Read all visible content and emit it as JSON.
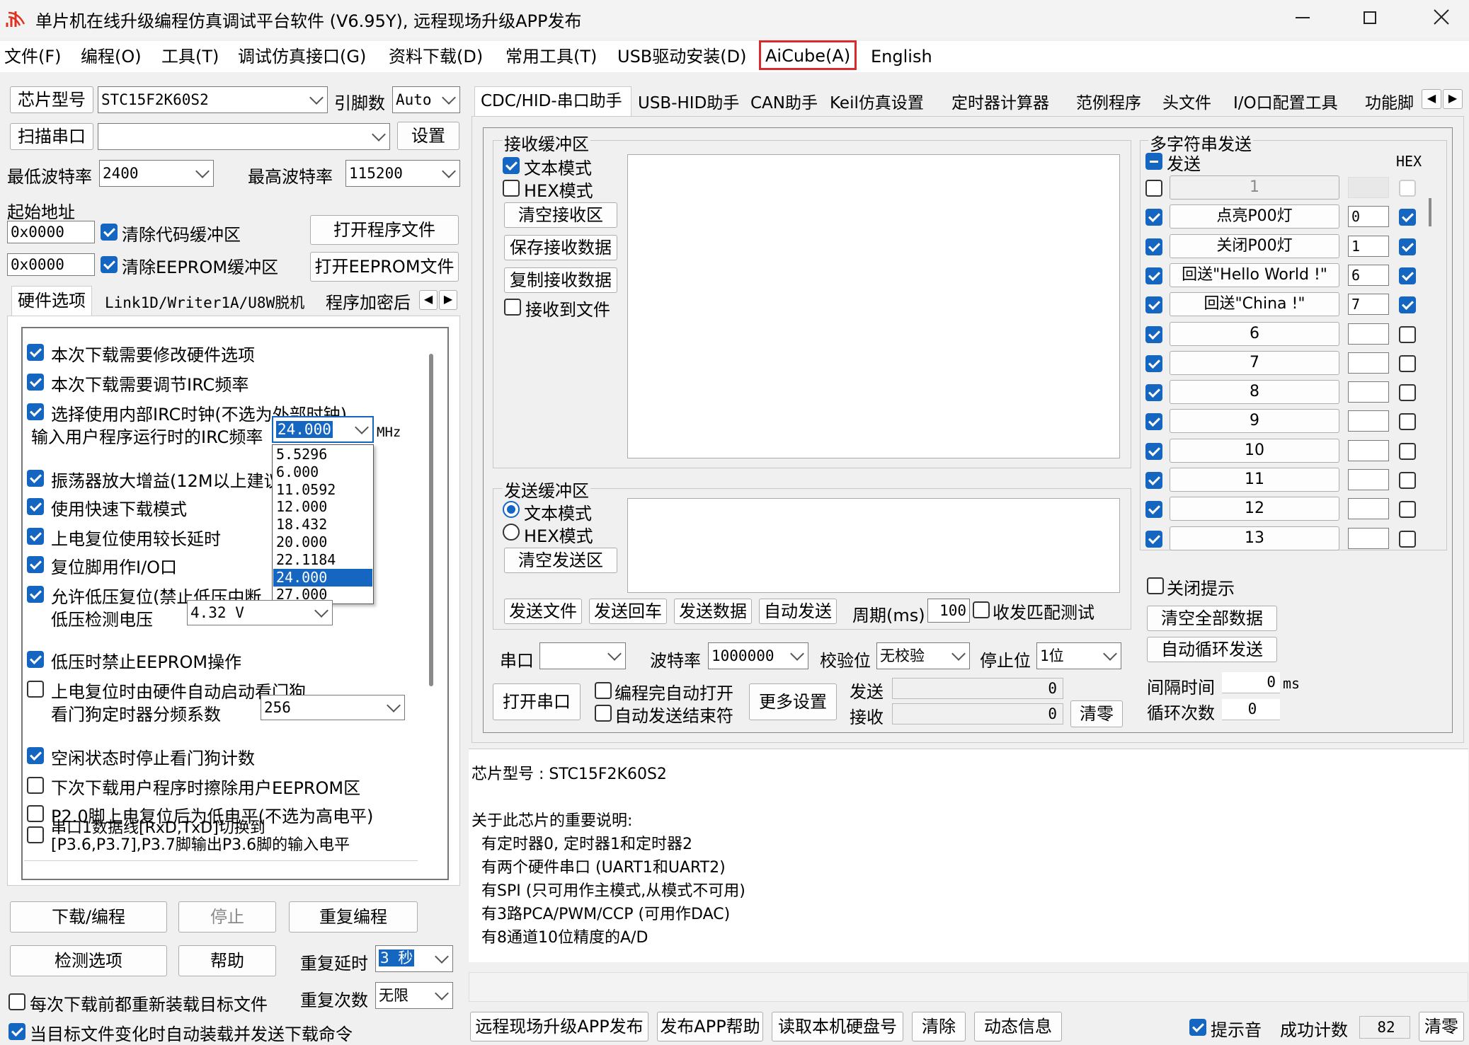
{
  "window": {
    "title": "单片机在线升级编程仿真调试平台软件 (V6.95Y), 远程现场升级APP发布"
  },
  "menu": [
    "文件(F)",
    "编程(O)",
    "工具(T)",
    "调试仿真接口(G)",
    "资料下载(D)",
    "常用工具(T)",
    "USB驱动安装(D)",
    "AiCube(A)",
    "English"
  ],
  "left": {
    "chip_btn": "芯片型号",
    "chip": "STC15F2K60S2",
    "pins_label": "引脚数",
    "pins": "Auto",
    "scan_btn": "扫描串口",
    "port": "",
    "settings_btn": "设置",
    "min_baud_label": "最低波特率",
    "min_baud": "2400",
    "max_baud_label": "最高波特率",
    "max_baud": "115200",
    "start_addr_label": "起始地址",
    "addr1": "0x0000",
    "clear_code": "清除代码缓冲区",
    "open_prog": "打开程序文件",
    "addr2": "0x0000",
    "clear_eeprom": "清除EEPROM缓冲区",
    "open_eeprom": "打开EEPROM文件",
    "tabs": [
      "硬件选项",
      "Link1D/Writer1A/U8W脱机",
      "程序加密后"
    ],
    "opts": [
      {
        "text": "本次下载需要修改硬件选项",
        "on": true
      },
      {
        "text": "本次下载需要调节IRC频率",
        "on": true
      },
      {
        "text": "选择使用内部IRC时钟(不选为外部时钟)",
        "on": true
      },
      {
        "text": "振荡器放大增益(12M以上建议",
        "on": true
      },
      {
        "text": "使用快速下载模式",
        "on": true
      },
      {
        "text": "上电复位使用较长延时",
        "on": true
      },
      {
        "text": "复位脚用作I/O口",
        "on": true
      },
      {
        "text": "允许低压复位(禁止低压中断",
        "on": true
      },
      {
        "text": "低压时禁止EEPROM操作",
        "on": true
      },
      {
        "text": "上电复位时由硬件自动启动看门狗",
        "on": false
      },
      {
        "text": "空闲状态时停止看门狗计数",
        "on": true
      },
      {
        "text": "下次下载用户程序时擦除用户EEPROM区",
        "on": false
      },
      {
        "text": "P2.0脚上电复位后为低电平(不选为高电平)",
        "on": false
      }
    ],
    "irc_label": "输入用户程序运行时的IRC频率",
    "irc_value": "24.000",
    "irc_unit": "MHz",
    "irc_options": [
      "5.5296",
      "6.000",
      "11.0592",
      "12.000",
      "18.432",
      "20.000",
      "22.1184",
      "24.000",
      "27.000"
    ],
    "lv_label": "低压检测电压",
    "lv_value": "4.32 V",
    "wdt_label": "看门狗定时器分频系数",
    "wdt_value": "256",
    "serial_opt_line1": "串口1数据线[RxD,TxD]切换到",
    "serial_opt_line2": "[P3.6,P3.7],P3.7脚输出P3.6脚的输入电平",
    "download_btn": "下载/编程",
    "stop_btn": "停止",
    "reprog_btn": "重复编程",
    "check_btn": "检测选项",
    "help_btn": "帮助",
    "delay_label": "重复延时",
    "delay_value": "3 秒",
    "count_label": "重复次数",
    "count_value": "无限",
    "reload_label": "每次下载前都重新装载目标文件",
    "autoload_label": "当目标文件变化时自动装载并发送下载命令"
  },
  "right": {
    "tabs": [
      "CDC/HID-串口助手",
      "USB-HID助手",
      "CAN助手",
      "Keil仿真设置",
      "定时器计算器",
      "范例程序",
      "头文件",
      "I/O口配置工具",
      "功能脚"
    ],
    "recv": {
      "title": "接收缓冲区",
      "text_mode": "文本模式",
      "hex_mode": "HEX模式",
      "clear": "清空接收区",
      "save": "保存接收数据",
      "copy": "复制接收数据",
      "to_file": "接收到文件"
    },
    "send": {
      "title": "发送缓冲区",
      "text_mode": "文本模式",
      "hex_mode": "HEX模式",
      "clear": "清空发送区",
      "file": "发送文件",
      "enter": "发送回车",
      "data": "发送数据",
      "auto": "自动发送",
      "period_label": "周期(ms)",
      "period": "100",
      "match": "收发匹配测试"
    },
    "port_label": "串口",
    "port": "",
    "baud_label": "波特率",
    "baud": "1000000",
    "parity_label": "校验位",
    "parity": "无校验",
    "stop_label": "停止位",
    "stop": "1位",
    "open_btn": "打开串口",
    "auto_open": "编程完自动打开",
    "auto_end": "自动发送结束符",
    "more_btn": "更多设置",
    "send_label": "发送",
    "send_count": "0",
    "recv_label": "接收",
    "recv_count": "0",
    "zero_btn": "清零",
    "multi": {
      "title": "多字符串发送",
      "send": "发送",
      "hex": "HEX",
      "rows": [
        {
          "on": false,
          "label": "1",
          "num": "",
          "hex": false,
          "dim": true
        },
        {
          "on": true,
          "label": "点亮P00灯",
          "num": "0",
          "hex": true
        },
        {
          "on": true,
          "label": "关闭P00灯",
          "num": "1",
          "hex": true
        },
        {
          "on": true,
          "label": "回送\"Hello World !\"",
          "num": "6",
          "hex": true
        },
        {
          "on": true,
          "label": "回送\"China !\"",
          "num": "7",
          "hex": true
        },
        {
          "on": true,
          "label": "6",
          "num": "",
          "hex": false
        },
        {
          "on": true,
          "label": "7",
          "num": "",
          "hex": false
        },
        {
          "on": true,
          "label": "8",
          "num": "",
          "hex": false
        },
        {
          "on": true,
          "label": "9",
          "num": "",
          "hex": false
        },
        {
          "on": true,
          "label": "10",
          "num": "",
          "hex": false
        },
        {
          "on": true,
          "label": "11",
          "num": "",
          "hex": false
        },
        {
          "on": true,
          "label": "12",
          "num": "",
          "hex": false
        },
        {
          "on": true,
          "label": "13",
          "num": "",
          "hex": false
        }
      ],
      "close_tip": "关闭提示",
      "clear_all": "清空全部数据",
      "auto_loop": "自动循环发送",
      "interval_label": "间隔时间",
      "interval": "0",
      "interval_unit": "ms",
      "loop_label": "循环次数",
      "loop": "0"
    }
  },
  "info": {
    "lines": [
      "芯片型号 : STC15F2K60S2",
      "",
      "关于此芯片的重要说明:",
      "  有定时器0, 定时器1和定时器2",
      "  有两个硬件串口 (UART1和UART2)",
      "  有SPI (只可用作主模式,从模式不可用)",
      "  有3路PCA/PWM/CCP (可用作DAC)",
      "  有8通道10位精度的A/D"
    ]
  },
  "bottom": {
    "publish": "远程现场升级APP发布",
    "pub_help": "发布APP帮助",
    "read_disk": "读取本机硬盘号",
    "clear": "清除",
    "dyn": "动态信息",
    "beep": "提示音",
    "success_label": "成功计数",
    "success": "82",
    "zero": "清零"
  }
}
